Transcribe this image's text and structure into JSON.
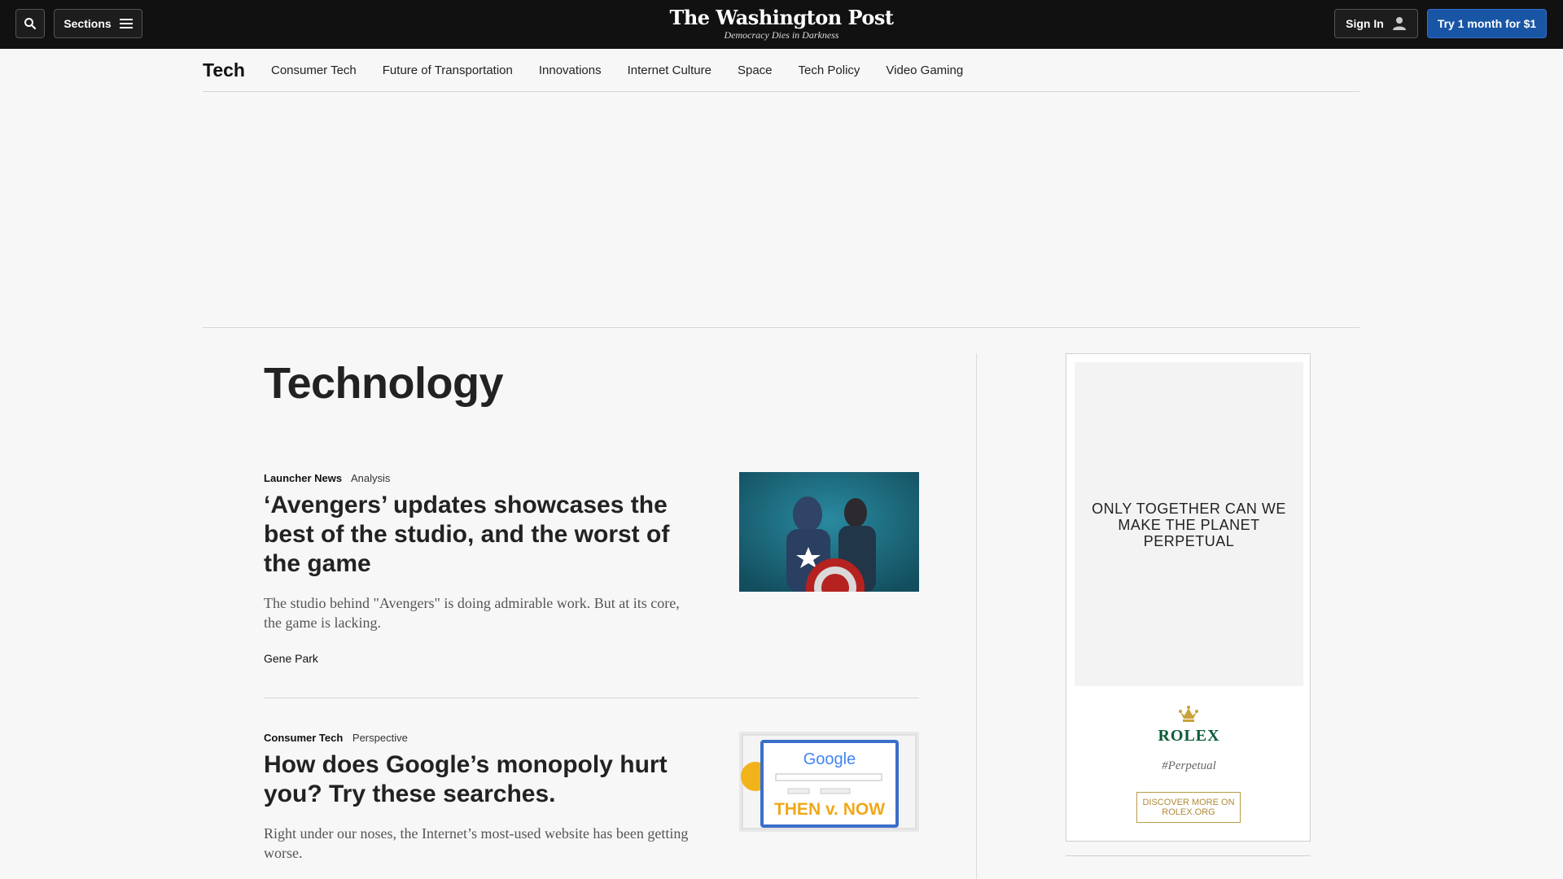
{
  "header": {
    "sections_label": "Sections",
    "logo": "The Washington Post",
    "tagline": "Democracy Dies in Darkness",
    "signin_label": "Sign In",
    "subscribe_label": "Try 1 month for $1"
  },
  "subnav": {
    "section": "Tech",
    "items": [
      "Consumer Tech",
      "Future of Transportation",
      "Innovations",
      "Internet Culture",
      "Space",
      "Tech Policy",
      "Video Gaming"
    ]
  },
  "page": {
    "title": "Technology"
  },
  "stories": [
    {
      "kicker": "Launcher News",
      "label": "Analysis",
      "headline": "‘Avengers’ updates showcases the best of the studio, and the worst of the game",
      "blurb": "The studio behind \"Avengers\" is doing admirable work. But at its core, the game is lacking.",
      "byline": "Gene Park"
    },
    {
      "kicker": "Consumer Tech",
      "label": "Perspective",
      "headline": "How does Google’s monopoly hurt you? Try these searches.",
      "blurb": "Right under our noses, the Internet’s most-used website has been getting worse.",
      "thumb_logo": "Google",
      "thumb_caption": "THEN v. NOW"
    }
  ],
  "ad": {
    "headline": "ONLY TOGETHER CAN WE MAKE THE PLANET PERPETUAL",
    "brand": "ROLEX",
    "hashtag": "#Perpetual",
    "cta": "DISCOVER MORE ON ROLEX.ORG"
  },
  "colors": {
    "topbar": "#111111",
    "subscribe": "#1955a5",
    "rolex_green": "#0a5c36"
  }
}
